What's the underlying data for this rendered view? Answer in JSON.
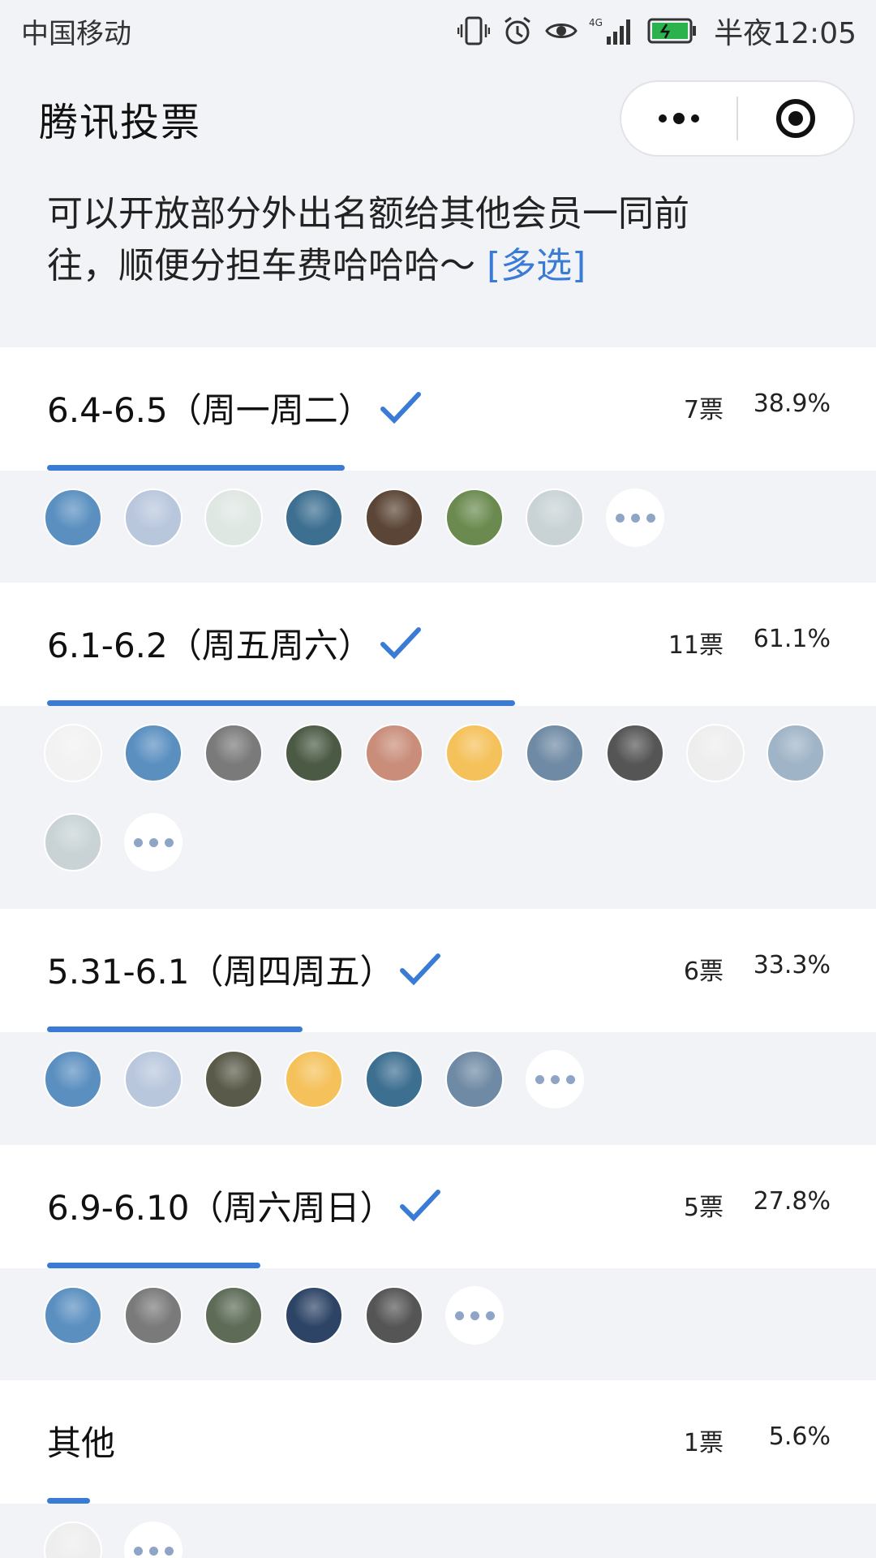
{
  "status_bar": {
    "carrier": "中国移动",
    "network": "4G+",
    "time": "半夜12:05"
  },
  "nav": {
    "title": "腾讯投票",
    "more_icon": "more-dots-icon",
    "close_icon": "target-close-icon"
  },
  "question": {
    "text": "可以开放部分外出名额给其他会员一同前往，顺便分担车费哈哈哈～",
    "tag": "[多选]"
  },
  "accent_color": "#3a7bd5",
  "options": [
    {
      "label": "6.4-6.5（周一周二）",
      "checked": true,
      "votes": "7票",
      "percent": "38.9%",
      "fraction": 0.389,
      "avatars": [
        "#5a8fc0",
        "#b9c7dd",
        "#dfe7e3",
        "#3d6f91",
        "#5b4536",
        "#6a8a4f",
        "#c9d3d6"
      ],
      "more": true
    },
    {
      "label": "6.1-6.2（周五周六）",
      "checked": true,
      "votes": "11票",
      "percent": "61.1%",
      "fraction": 0.611,
      "avatars": [
        "#f2f2f2",
        "#5a8fc0",
        "#7a7a7a",
        "#4b5a44",
        "#c98d7a",
        "#f5c15a",
        "#6f8aa4",
        "#555555",
        "#eeeeee",
        "#9fb4c6",
        "#c9d3d6"
      ],
      "more": true
    },
    {
      "label": "5.31-6.1（周四周五）",
      "checked": true,
      "votes": "6票",
      "percent": "33.3%",
      "fraction": 0.333,
      "avatars": [
        "#5a8fc0",
        "#b9c7dd",
        "#5a5a4a",
        "#f5c15a",
        "#3d6f91",
        "#6f8aa4"
      ],
      "more": true
    },
    {
      "label": "6.9-6.10（周六周日）",
      "checked": true,
      "votes": "5票",
      "percent": "27.8%",
      "fraction": 0.278,
      "avatars": [
        "#5a8fc0",
        "#7a7a7a",
        "#5d6b57",
        "#2d4466",
        "#555555"
      ],
      "more": true
    },
    {
      "label": "其他",
      "checked": false,
      "votes": "1票",
      "percent": "5.6%",
      "fraction": 0.056,
      "avatars": [
        "#eeeeee"
      ],
      "more": true
    }
  ]
}
